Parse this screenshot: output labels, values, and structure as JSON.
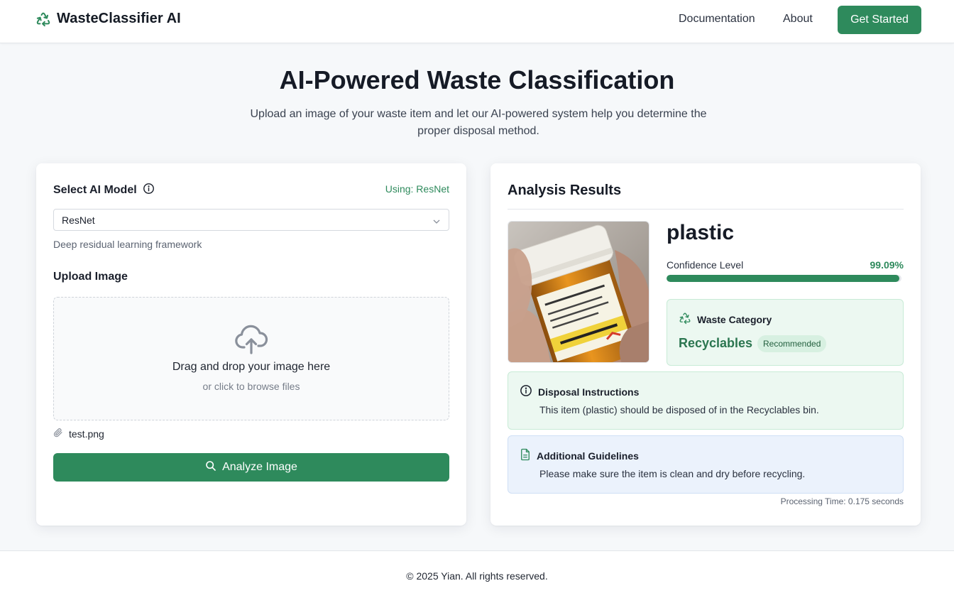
{
  "nav": {
    "brand": "WasteClassifier AI",
    "brand_icon": "recycle-icon",
    "links": [
      "Documentation",
      "About"
    ],
    "cta": "Get Started"
  },
  "hero": {
    "title": "AI-Powered Waste Classification",
    "subtitle": "Upload an image of your waste item and let our AI-powered system help you determine the proper disposal method."
  },
  "model_panel": {
    "label": "Select AI Model",
    "using": "Using: ResNet",
    "selected_model": "ResNet",
    "description": "Deep residual learning framework",
    "upload_label": "Upload Image",
    "drop_main": "Drag and drop your image here",
    "drop_sub": "or click to browse files",
    "file_name": "test.png",
    "analyze_label": "Analyze Image"
  },
  "results": {
    "title": "Analysis Results",
    "image_alt": "Photo of an orange pill bottle with a white cap held in a hand",
    "class_name": "plastic",
    "confidence_label": "Confidence Level",
    "confidence_value": "99.09%",
    "confidence_fraction": 0.9909,
    "category_heading": "Waste Category",
    "category": "Recyclables",
    "badge": "Recommended",
    "disposal_heading": "Disposal Instructions",
    "disposal_text": "This item (plastic) should be disposed of in the Recyclables bin.",
    "guidelines_heading": "Additional Guidelines",
    "guidelines_text": "Please make sure the item is clean and dry before recycling.",
    "processing_time": "Processing Time: 0.175 seconds"
  },
  "footer": {
    "copyright": "© 2025 Yian. All rights reserved."
  },
  "colors": {
    "accent": "#2e8a5c",
    "green_box": "#ecf8f1",
    "blue_box": "#ebf2fc"
  }
}
